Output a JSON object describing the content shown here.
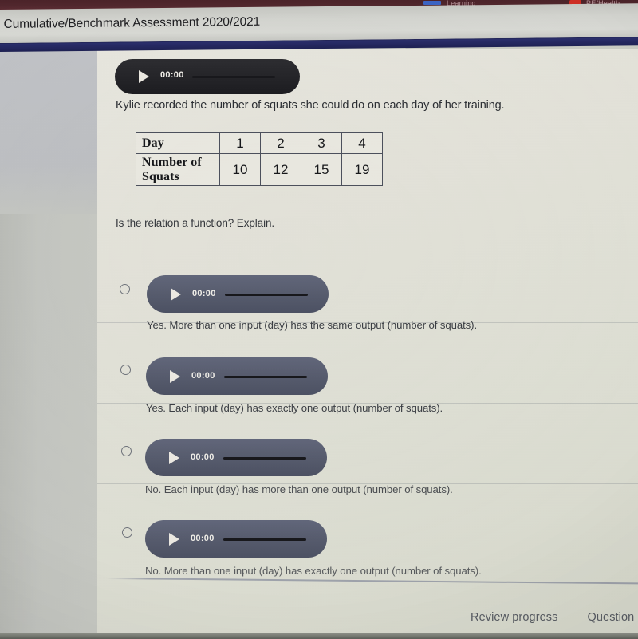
{
  "browser": {
    "tab_text_partial": "PE/Health",
    "tab_text_partial_2": "Learning",
    "bookmark_icon": "bookmark-icon"
  },
  "window": {
    "title": ": Cumulative/Benchmark Assessment 2020/2021"
  },
  "prompt": {
    "audio": {
      "time": "00:00",
      "play_icon": "play-icon"
    },
    "text": "Kylie recorded the number of squats she could do on each day of her training."
  },
  "table": {
    "rows": [
      {
        "header": "Day",
        "cells": [
          "1",
          "2",
          "3",
          "4"
        ]
      },
      {
        "header": "Number of Squats",
        "cells": [
          "10",
          "12",
          "15",
          "19"
        ]
      }
    ]
  },
  "question": {
    "stem": "Is the relation a function? Explain.",
    "options": [
      {
        "audio_time": "00:00",
        "text": "Yes. More than one input (day) has the same output (number of squats).",
        "selected": false
      },
      {
        "audio_time": "00:00",
        "text": "Yes. Each input (day) has exactly one output (number of squats).",
        "selected": false
      },
      {
        "audio_time": "00:00",
        "text": "No. Each input (day) has more than one output (number of squats).",
        "selected": false
      },
      {
        "audio_time": "00:00",
        "text": "No. More than one input (day) has exactly one output (number of squats).",
        "selected": false
      }
    ]
  },
  "footer": {
    "review_progress": "Review progress",
    "question_label": "Question"
  },
  "colors": {
    "browser_bar": "#50262c",
    "titlebar": "#d3d4cf",
    "navy_band": "#23265e",
    "sheet": "#e3e2d9",
    "player_top": "#232327",
    "player_option": "#565b6d",
    "table_border": "#4b4f5c",
    "text_primary": "#2b2e33"
  }
}
